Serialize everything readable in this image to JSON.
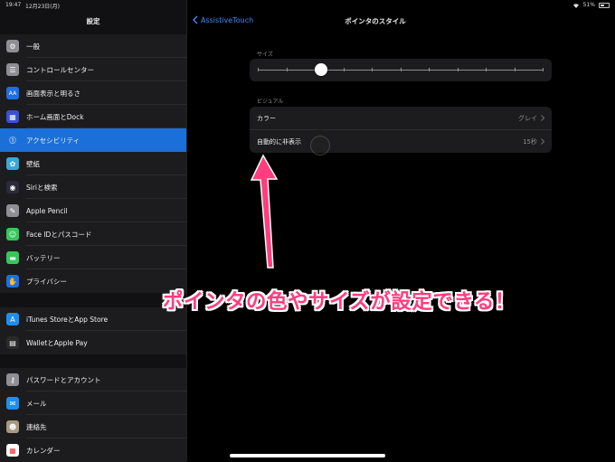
{
  "status_bar": {
    "time": "19:47",
    "date": "12月23日(月)",
    "battery_text": "51%",
    "battery_level": 0.51
  },
  "sidebar": {
    "title": "設定",
    "groups": [
      {
        "items": [
          {
            "label": "一般",
            "icon": "gear-icon",
            "color": "#8e8e93",
            "glyph": "⚙"
          },
          {
            "label": "コントロールセンター",
            "icon": "switches-icon",
            "color": "#8e8e93",
            "glyph": "☰"
          },
          {
            "label": "画面表示と明るさ",
            "icon": "text-size-icon",
            "color": "#1e6ee8",
            "glyph": "AA"
          },
          {
            "label": "ホーム画面とDock",
            "icon": "app-grid-icon",
            "color": "#3a4fd8",
            "glyph": "▦"
          },
          {
            "label": "アクセシビリティ",
            "icon": "accessibility-icon",
            "color": "#1b6fd8",
            "glyph": "⓵",
            "selected": true
          },
          {
            "label": "壁紙",
            "icon": "flower-icon",
            "color": "#38a8d8",
            "glyph": "✿"
          },
          {
            "label": "Siriと検索",
            "icon": "siri-icon",
            "color": "#2a2a3a",
            "glyph": "◉"
          },
          {
            "label": "Apple Pencil",
            "icon": "pencil-icon",
            "color": "#8e8e93",
            "glyph": "✎"
          },
          {
            "label": "Face IDとパスコード",
            "icon": "face-id-icon",
            "color": "#34c759",
            "glyph": "☺"
          },
          {
            "label": "バッテリー",
            "icon": "battery-icon",
            "color": "#34c759",
            "glyph": "▬"
          },
          {
            "label": "プライバシー",
            "icon": "hand-icon",
            "color": "#1e6ee8",
            "glyph": "✋"
          }
        ]
      },
      {
        "items": [
          {
            "label": "iTunes StoreとApp Store",
            "icon": "app-store-icon",
            "color": "#1e8ef0",
            "glyph": "A"
          },
          {
            "label": "WalletとApple Pay",
            "icon": "wallet-icon",
            "color": "#2a2a2a",
            "glyph": "▤"
          }
        ]
      },
      {
        "items": [
          {
            "label": "パスワードとアカウント",
            "icon": "key-icon",
            "color": "#8e8e93",
            "glyph": "⚷"
          },
          {
            "label": "メール",
            "icon": "mail-icon",
            "color": "#1e8ef0",
            "glyph": "✉"
          },
          {
            "label": "連絡先",
            "icon": "contacts-icon",
            "color": "#a89a80",
            "glyph": "☻"
          },
          {
            "label": "カレンダー",
            "icon": "calendar-icon",
            "color": "#ffffff",
            "glyph": "▦"
          }
        ]
      }
    ]
  },
  "main": {
    "back_label": "AssistiveTouch",
    "title": "ポインタのスタイル",
    "size_header": "サイズ",
    "size_slider": {
      "ticks": 11,
      "value_fraction": 0.22
    },
    "visual_header": "ビジュアル",
    "rows": [
      {
        "label": "カラー",
        "value": "グレイ"
      },
      {
        "label": "自動的に非表示",
        "value": "15秒"
      }
    ]
  },
  "annotation": {
    "text": "ポインタの色やサイズが設定できる！",
    "color": "#ff3d7f"
  }
}
